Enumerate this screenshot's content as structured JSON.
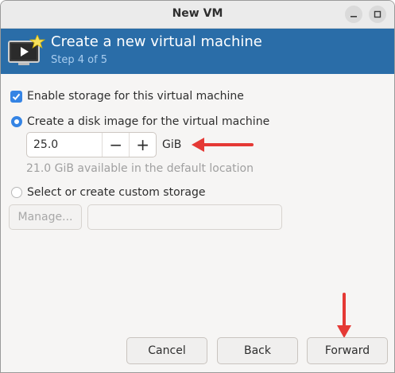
{
  "window": {
    "title": "New VM"
  },
  "banner": {
    "heading": "Create a new virtual machine",
    "step": "Step 4 of 5"
  },
  "storage": {
    "enable_label": "Enable storage for this virtual machine",
    "enable_checked": true,
    "disk_image_label": "Create a disk image for the virtual machine",
    "disk_image_selected": true,
    "size_value": "25.0",
    "decrement_label": "−",
    "increment_label": "+",
    "size_unit": "GiB",
    "available_hint": "21.0 GiB available in the default location",
    "custom_label": "Select or create custom storage",
    "custom_selected": false,
    "manage_label": "Manage...",
    "custom_path_value": ""
  },
  "buttons": {
    "cancel": "Cancel",
    "back": "Back",
    "forward": "Forward"
  },
  "colors": {
    "banner": "#2a6da8",
    "accent": "#3584e4",
    "annotation_arrow": "#e53935"
  },
  "icons": {
    "minimize": "minimize-icon",
    "maximize": "maximize-icon",
    "banner": "vm-monitor-icon",
    "checkbox": "checkmark-icon"
  }
}
